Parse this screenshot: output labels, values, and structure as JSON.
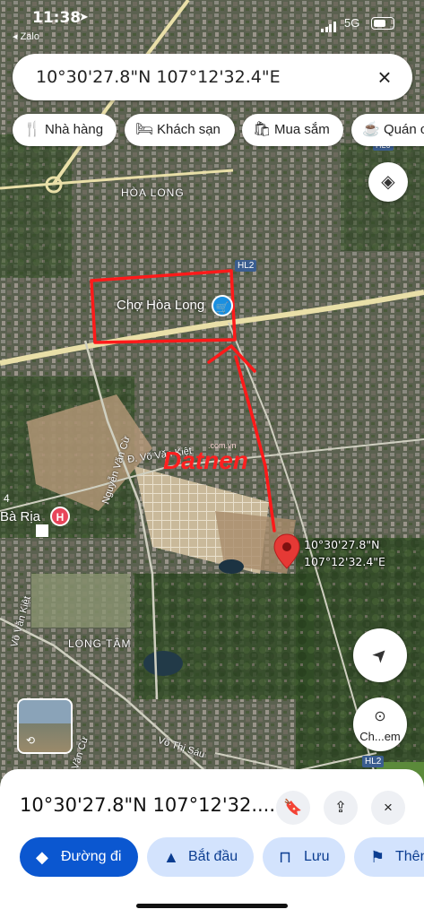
{
  "status": {
    "time": "11:38",
    "back": "◂ Zalo",
    "network": "5G"
  },
  "search": {
    "query": "10°30'27.8\"N 107°12'32.4\"E"
  },
  "chips": [
    {
      "icon": "fork-knife-icon",
      "label": "Nhà hàng"
    },
    {
      "icon": "bed-icon",
      "label": "Khách sạn"
    },
    {
      "icon": "shopping-bag-icon",
      "label": "Mua sắm"
    },
    {
      "icon": "coffee-icon",
      "label": "Quán c"
    }
  ],
  "map_labels": {
    "hoa_long": "HÒA LONG",
    "cho_hoa_long": "Chợ Hòa Long",
    "hl2_top": "HL2",
    "hl2_bottom": "HL2",
    "hl6": "HL6",
    "vo_van_kiet": "Đ. Võ Văn Kiệt",
    "nguyen_van_cu": "Nguyễn Văn Cừ",
    "ba_ria": "Bà Rịa",
    "ba_ria_prefix": "4",
    "long_tam": "LONG TÂM",
    "vo_thi_sau": "Võ Thị Sáu",
    "vo_van_kiet_left": "Võ Văn Kiệt",
    "van_cu_bottom": "Văn Cừ",
    "watermark_domain": ".com.vn",
    "watermark": "Datnen",
    "pin_lat": "10°30'27.8\"N",
    "pin_lng": "107°12'32.4\"E",
    "hospital": "H"
  },
  "controls": {
    "layers": "layers-icon",
    "navigate": "navigation-arrow-icon",
    "camera_label": "Ch...em"
  },
  "sheet": {
    "title": "10°30'27.8\"N 107°12'32....",
    "actions": [
      {
        "icon": "directions-icon",
        "label": "Đường đi"
      },
      {
        "icon": "start-icon",
        "label": "Bắt đầu"
      },
      {
        "icon": "bookmark-icon",
        "label": "Lưu"
      },
      {
        "icon": "flag-icon",
        "label": "Thên"
      }
    ]
  },
  "colors": {
    "accent": "#0b57d0",
    "pin": "#e53935",
    "annotation": "#ff1a1a",
    "road": "#f2e6a6"
  }
}
